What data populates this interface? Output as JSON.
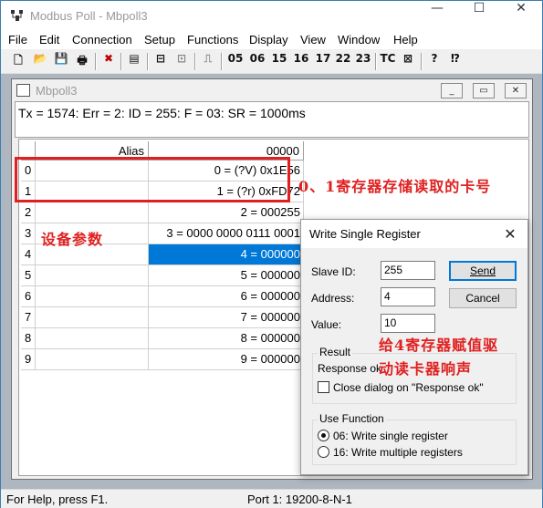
{
  "app": {
    "title": "Modbus Poll - Mbpoll3",
    "icon": "app-logo-icon",
    "minimize_glyph": "—",
    "maximize_glyph": "☐",
    "close_glyph": "✕"
  },
  "menu": [
    "File",
    "Edit",
    "Connection",
    "Setup",
    "Functions",
    "Display",
    "View",
    "Window",
    "Help"
  ],
  "toolbar": {
    "icons": [
      "new-file-icon",
      "open-folder-icon",
      "save-icon",
      "print-icon",
      "disconnect-icon",
      "window-icon",
      "connect-icon",
      "read-icon",
      "pulse-icon"
    ],
    "func_codes": [
      "05",
      "06",
      "15",
      "16",
      "17",
      "22",
      "23"
    ],
    "tc_label": "TC",
    "help_icons": [
      "monitor-icon",
      "help-icon",
      "context-help-icon"
    ],
    "glyphs": {
      "new": "🗋",
      "open": "📂",
      "save": "💾",
      "print": "🖶",
      "cut": "✖",
      "window": "▤",
      "connect": "⊟",
      "read": "⊡",
      "pulse": "⎍",
      "monitor": "⊠",
      "help": "?",
      "ctxhelp": "⁉"
    }
  },
  "child": {
    "title": "Mbpoll3",
    "status": "Tx = 1574: Err = 2: ID = 255: F = 03: SR = 1000ms",
    "buttons": {
      "min": "_",
      "max": "▭",
      "close": "✕"
    }
  },
  "grid": {
    "col_alias": "Alias",
    "col_addr": "00000",
    "rows": [
      {
        "index": "0",
        "alias": "",
        "value": "0 = (?V) 0x1E56"
      },
      {
        "index": "1",
        "alias": "",
        "value": "1 = (?r) 0xFD72"
      },
      {
        "index": "2",
        "alias": "",
        "value": "2 = 000255"
      },
      {
        "index": "3",
        "alias": "",
        "value": "3 = 0000 0000 0111 0001"
      },
      {
        "index": "4",
        "alias": "",
        "value": "4 = 000000"
      },
      {
        "index": "5",
        "alias": "",
        "value": "5 = 000000"
      },
      {
        "index": "6",
        "alias": "",
        "value": "6 = 000000"
      },
      {
        "index": "7",
        "alias": "",
        "value": "7 = 000000"
      },
      {
        "index": "8",
        "alias": "",
        "value": "8 = 000000"
      },
      {
        "index": "9",
        "alias": "",
        "value": "9 = 000000"
      }
    ],
    "selected_row": 4
  },
  "annotations": {
    "card_read": "0、1寄存器存储读取的卡号",
    "device_params": "设备参数",
    "buzzer_line1": "给4寄存器赋值驱",
    "buzzer_line2": "动读卡器响声",
    "color": "#e02020"
  },
  "dialog": {
    "title": "Write Single Register",
    "close_glyph": "✕",
    "slave_id_label": "Slave ID:",
    "slave_id_value": "255",
    "address_label": "Address:",
    "address_value": "4",
    "value_label": "Value:",
    "value_value": "10",
    "send_label": "Send",
    "cancel_label": "Cancel",
    "result_group": "Result",
    "result_text": "Response ok",
    "close_on_ok": "Close dialog on \"Response ok\"",
    "close_on_ok_checked": false,
    "func_group": "Use Function",
    "func_06": "06: Write single register",
    "func_16": "16: Write multiple registers",
    "selected_function": "06"
  },
  "statusbar": {
    "help": "For Help, press F1.",
    "port": "Port 1: 19200-8-N-1"
  },
  "colors": {
    "selection": "#0078d7",
    "annotation": "#e02020",
    "mdi_background": "#aeb6bf"
  }
}
